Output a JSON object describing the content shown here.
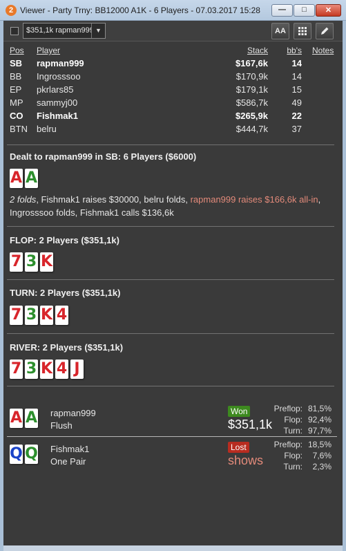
{
  "window": {
    "app_badge": "2",
    "title": "Viewer - Party Trny: BB12000 A1K - 6 Players - 07.03.2017 15:28",
    "min_glyph": "—",
    "max_glyph": "□",
    "close_glyph": "✕"
  },
  "toolbar": {
    "hand_select_value": "$351,1k rapman999",
    "font_button_label": "AA",
    "icons": [
      "font-size-icon",
      "grid-icon",
      "pencil-icon"
    ]
  },
  "players_table": {
    "headers": {
      "pos": "Pos",
      "player": "Player",
      "stack": "Stack",
      "bbs": "bb's",
      "notes": "Notes"
    },
    "rows": [
      {
        "pos": "SB",
        "name": "rapman999",
        "stack": "$167,6k",
        "bbs": "14",
        "bold": true
      },
      {
        "pos": "BB",
        "name": "Ingrosssoo",
        "stack": "$170,9k",
        "bbs": "14",
        "bold": false
      },
      {
        "pos": "EP",
        "name": "pkrlars85",
        "stack": "$179,1k",
        "bbs": "15",
        "bold": false
      },
      {
        "pos": "MP",
        "name": "sammyj00",
        "stack": "$586,7k",
        "bbs": "49",
        "bold": false
      },
      {
        "pos": "CO",
        "name": "Fishmak1",
        "stack": "$265,9k",
        "bbs": "22",
        "bold": true
      },
      {
        "pos": "BTN",
        "name": "belru",
        "stack": "$444,7k",
        "bbs": "37",
        "bold": false
      }
    ]
  },
  "preflop": {
    "header": "Dealt to rapman999 in SB: 6 Players ($6000)",
    "cards": [
      {
        "rank": "A",
        "suit": "heart"
      },
      {
        "rank": "A",
        "suit": "club"
      }
    ],
    "action_1": "2 folds",
    "action_2": ", Fishmak1 raises $30000, belru folds, ",
    "action_hero": "rapman999 raises $166,6k all-in",
    "action_3": ", Ingrosssoo folds, Fishmak1 calls $136,6k"
  },
  "flop": {
    "header": "FLOP: 2 Players ($351,1k)",
    "cards": [
      {
        "rank": "7",
        "suit": "heart"
      },
      {
        "rank": "3",
        "suit": "club"
      },
      {
        "rank": "K",
        "suit": "heart"
      }
    ]
  },
  "turn": {
    "header": "TURN: 2 Players ($351,1k)",
    "cards": [
      {
        "rank": "7",
        "suit": "heart"
      },
      {
        "rank": "3",
        "suit": "club"
      },
      {
        "rank": "K",
        "suit": "heart"
      },
      {
        "rank": "4",
        "suit": "heart"
      }
    ]
  },
  "river": {
    "header": "RIVER: 2 Players ($351,1k)",
    "cards": [
      {
        "rank": "7",
        "suit": "heart"
      },
      {
        "rank": "3",
        "suit": "club"
      },
      {
        "rank": "K",
        "suit": "heart"
      },
      {
        "rank": "4",
        "suit": "heart"
      },
      {
        "rank": "J",
        "suit": "heart"
      }
    ]
  },
  "showdown": [
    {
      "name": "rapman999",
      "hand": "Flush",
      "result": "Won",
      "amount": "$351,1k",
      "amount_color": "#ffffff",
      "cards": [
        {
          "rank": "A",
          "suit": "heart"
        },
        {
          "rank": "A",
          "suit": "club"
        }
      ],
      "equity": [
        {
          "label": "Preflop:",
          "value": "81,5%"
        },
        {
          "label": "Flop:",
          "value": "92,4%"
        },
        {
          "label": "Turn:",
          "value": "97,7%"
        }
      ]
    },
    {
      "name": "Fishmak1",
      "hand": "One Pair",
      "result": "Lost",
      "amount": "shows",
      "amount_color": "#e38a7a",
      "cards": [
        {
          "rank": "Q",
          "suit": "diamond"
        },
        {
          "rank": "Q",
          "suit": "club"
        }
      ],
      "equity": [
        {
          "label": "Preflop:",
          "value": "18,5%"
        },
        {
          "label": "Flop:",
          "value": "7,6%"
        },
        {
          "label": "Turn:",
          "value": "2,3%"
        }
      ]
    }
  ],
  "colors": {
    "heart": "#d8252b",
    "club": "#2d8f2d",
    "diamond": "#1a43c8",
    "won": "#3d8a1f",
    "lost": "#b82c20",
    "hero_action": "#e38a7a"
  }
}
